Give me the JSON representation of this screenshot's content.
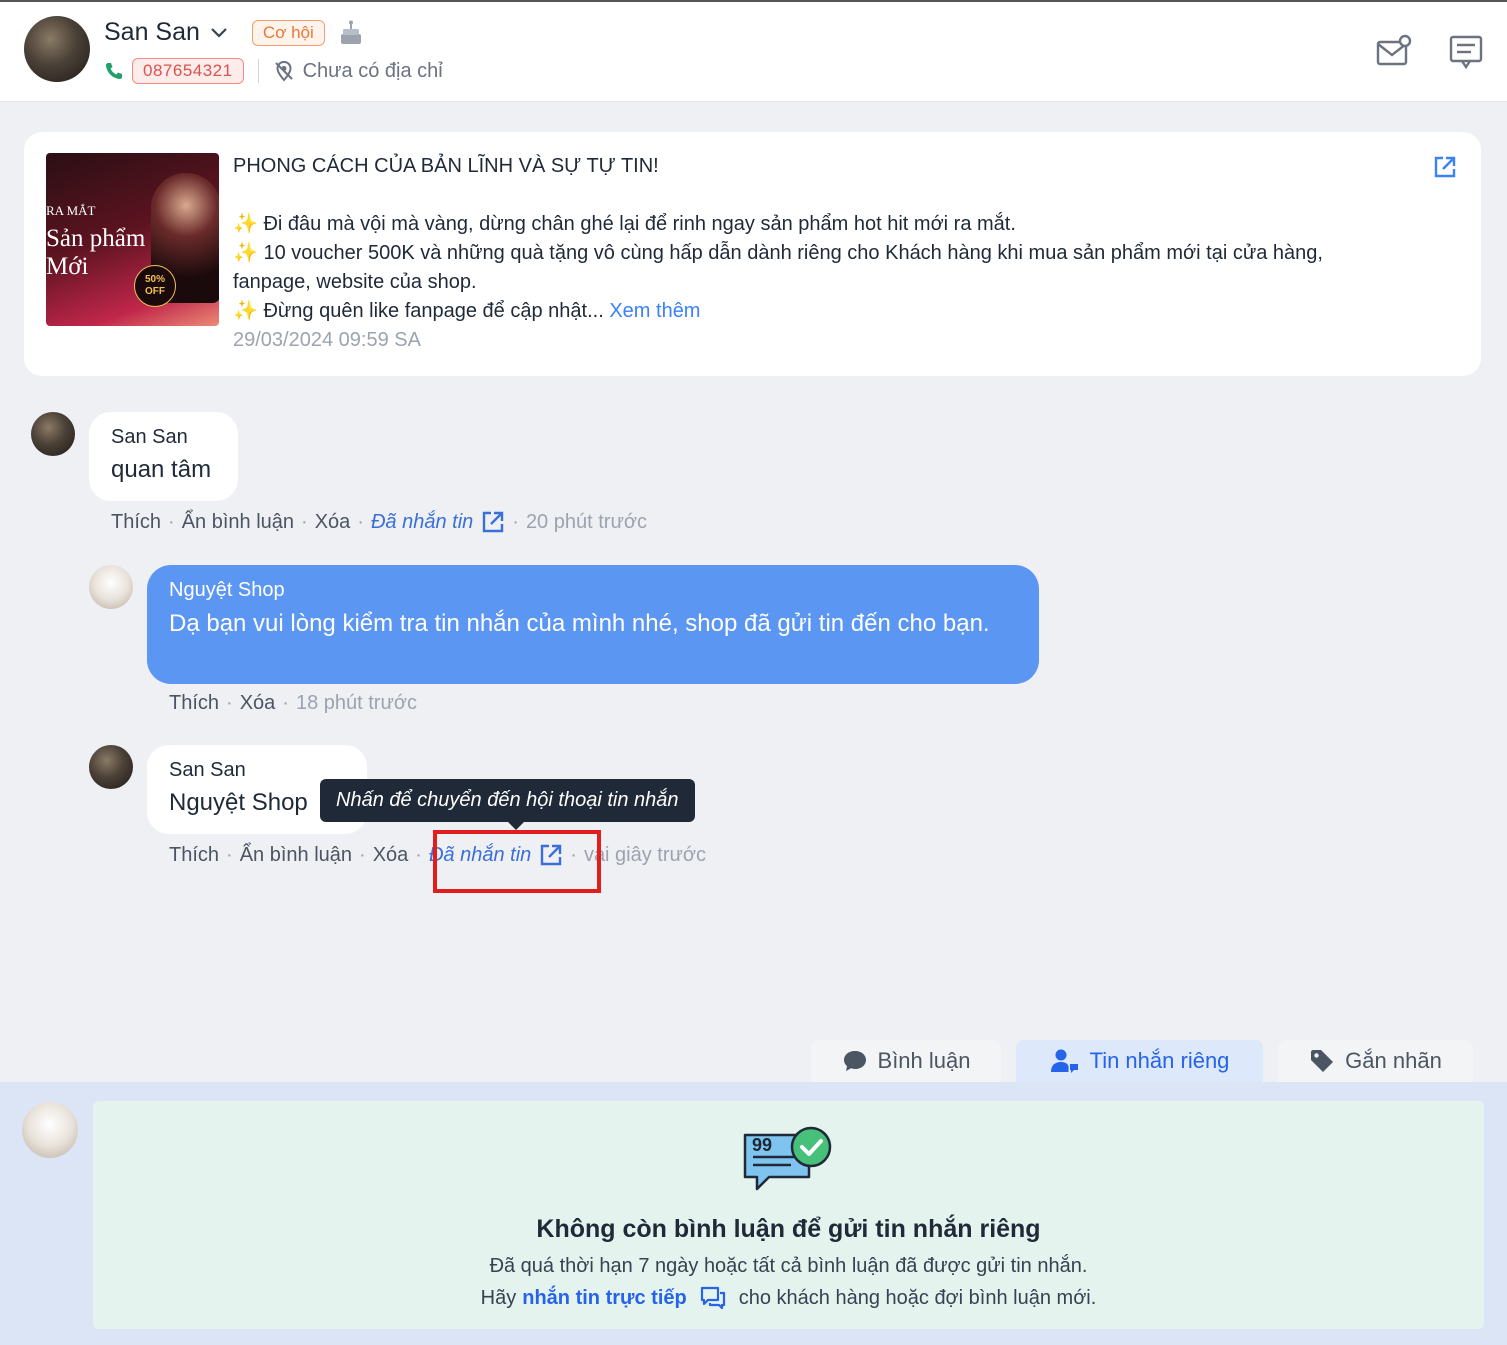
{
  "header": {
    "customer_name": "San San",
    "status_badge": "Cơ hội",
    "phone": "087654321",
    "address": "Chưa có địa chỉ"
  },
  "post": {
    "thumbnail_text": {
      "line1": "RA MẮT",
      "line2": "Sản phẩm",
      "line3": "Mới",
      "sticker": "50% OFF"
    },
    "title": "PHONG CÁCH CỦA BẢN LĨNH VÀ SỰ TỰ TIN!",
    "line1": "✨ Đi đâu mà vội mà vàng, dừng chân ghé lại để rinh ngay sản phẩm hot hit mới ra mắt.",
    "line2": "✨ 10 voucher 500K và những quà tặng vô cùng hấp dẫn dành riêng cho Khách hàng khi mua sản phẩm mới tại cửa hàng, fanpage, website của shop.",
    "line3": "✨ Đừng quên like fanpage để cập nhật...",
    "see_more": "Xem thêm",
    "timestamp": "29/03/2024 09:59 SA"
  },
  "comments": [
    {
      "author": "San San",
      "text": "quan tâm",
      "actions": {
        "like": "Thích",
        "hide": "Ẩn bình luận",
        "delete": "Xóa",
        "sent": "Đã nhắn tin",
        "time": "20 phút trước"
      }
    },
    {
      "author": "Nguyệt Shop",
      "text": "Dạ bạn vui lòng kiểm tra tin nhắn của mình nhé, shop đã gửi tin đến cho bạn.",
      "actions": {
        "like": "Thích",
        "delete": "Xóa",
        "time": "18 phút trước"
      }
    },
    {
      "author": "San San",
      "text": "Nguyệt Shop",
      "actions": {
        "like": "Thích",
        "hide": "Ẩn bình luận",
        "delete": "Xóa",
        "sent": "Đã nhắn tin",
        "time": "vài giây trước"
      }
    }
  ],
  "tooltip": "Nhấn để chuyển đến hội thoại tin nhắn",
  "tabs": [
    {
      "label": "Bình luận",
      "icon": "comment-icon",
      "active": false
    },
    {
      "label": "Tin nhắn riêng",
      "icon": "user-message-icon",
      "active": true
    },
    {
      "label": "Gắn nhãn",
      "icon": "tag-icon",
      "active": false
    }
  ],
  "empty_state": {
    "title": "Không còn bình luận để gửi tin nhắn riêng",
    "line1": "Đã quá thời hạn 7 ngày hoặc tất cả bình luận đã được gửi tin nhắn.",
    "line2_prefix": "Hãy",
    "line2_link": "nhắn tin trực tiếp",
    "line2_suffix": "cho khách hàng hoặc đợi bình luận mới."
  },
  "colors": {
    "accent": "#3b82f6",
    "shop_bubble": "#5b96f3",
    "highlight": "#e11d1d",
    "phone_badge": "#d9534f",
    "opportunity_badge": "#ea7a3a"
  }
}
